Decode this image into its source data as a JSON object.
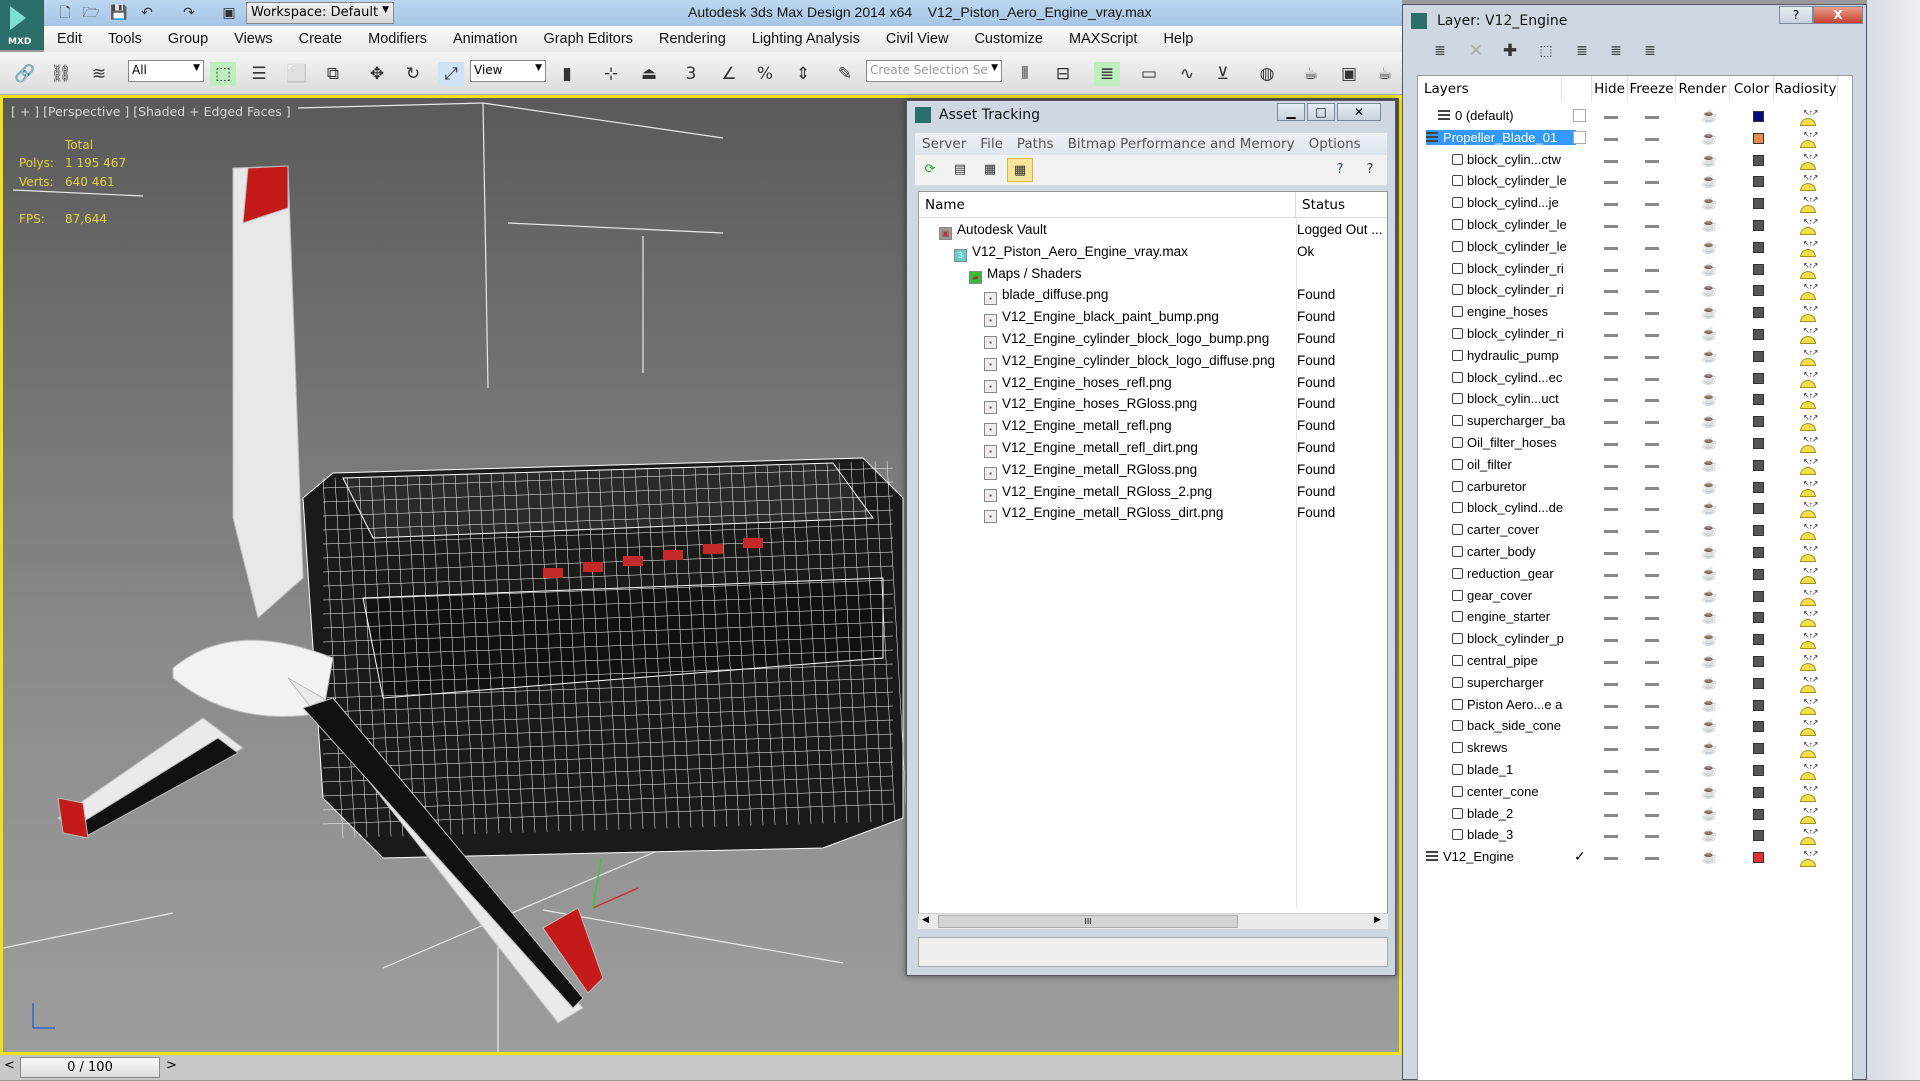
{
  "app": {
    "title": "Autodesk 3ds Max Design 2014 x64",
    "file": "V12_Piston_Aero_Engine_vray.max",
    "logo_text": "MXD",
    "workspace": "Workspace: Default"
  },
  "menu": [
    "Edit",
    "Tools",
    "Group",
    "Views",
    "Create",
    "Modifiers",
    "Animation",
    "Graph Editors",
    "Rendering",
    "Lighting Analysis",
    "Civil View",
    "Customize",
    "MAXScript",
    "Help"
  ],
  "toolbar": {
    "filter_value": "All",
    "coord_value": "View",
    "selection_set_placeholder": "Create Selection Se"
  },
  "viewport": {
    "label": "[ + ] [Perspective ] [Shaded + Edged Faces ]",
    "stats_header": "Total",
    "polys_label": "Polys:",
    "polys_value": "1 195 467",
    "verts_label": "Verts:",
    "verts_value": "640 461",
    "fps_label": "FPS:",
    "fps_value": "87,644"
  },
  "timeline": {
    "value": "0 / 100",
    "prev": "<",
    "next": ">"
  },
  "asset_tracking": {
    "title": "Asset Tracking",
    "menu": [
      "Server",
      "File",
      "Paths",
      "Bitmap Performance and Memory",
      "Options"
    ],
    "columns": {
      "name": "Name",
      "status": "Status"
    },
    "rows": [
      {
        "name": "Autodesk Vault",
        "status": "Logged Out ...",
        "level": 1,
        "icon": "vault"
      },
      {
        "name": "V12_Piston_Aero_Engine_vray.max",
        "status": "Ok",
        "level": 2,
        "icon": "max"
      },
      {
        "name": "Maps / Shaders",
        "status": "",
        "level": 3,
        "icon": "maps"
      },
      {
        "name": "blade_diffuse.png",
        "status": "Found",
        "level": 4,
        "icon": "bitmap"
      },
      {
        "name": "V12_Engine_black_paint_bump.png",
        "status": "Found",
        "level": 4,
        "icon": "bitmap"
      },
      {
        "name": "V12_Engine_cylinder_block_logo_bump.png",
        "status": "Found",
        "level": 4,
        "icon": "bitmap"
      },
      {
        "name": "V12_Engine_cylinder_block_logo_diffuse.png",
        "status": "Found",
        "level": 4,
        "icon": "bitmap"
      },
      {
        "name": "V12_Engine_hoses_refl.png",
        "status": "Found",
        "level": 4,
        "icon": "bitmap"
      },
      {
        "name": "V12_Engine_hoses_RGloss.png",
        "status": "Found",
        "level": 4,
        "icon": "bitmap"
      },
      {
        "name": "V12_Engine_metall_refl.png",
        "status": "Found",
        "level": 4,
        "icon": "bitmap"
      },
      {
        "name": "V12_Engine_metall_refl_dirt.png",
        "status": "Found",
        "level": 4,
        "icon": "bitmap"
      },
      {
        "name": "V12_Engine_metall_RGloss.png",
        "status": "Found",
        "level": 4,
        "icon": "bitmap"
      },
      {
        "name": "V12_Engine_metall_RGloss_2.png",
        "status": "Found",
        "level": 4,
        "icon": "bitmap"
      },
      {
        "name": "V12_Engine_metall_RGloss_dirt.png",
        "status": "Found",
        "level": 4,
        "icon": "bitmap"
      }
    ],
    "scroll_grip": "III"
  },
  "layer_dialog": {
    "title": "Layer: V12_Engine",
    "help": "?",
    "close": "X",
    "columns": {
      "layers": "Layers",
      "hide": "Hide",
      "freeze": "Freeze",
      "render": "Render",
      "color": "Color",
      "radiosity": "Radiosity"
    },
    "current_mark": "✓",
    "rows": [
      {
        "name": "0 (default)",
        "type": "layer",
        "color": "#0a0a80"
      },
      {
        "name": "Propeller_Blade_01",
        "type": "layer",
        "color": "#e88a4a",
        "selected": true
      },
      {
        "name": "block_cylin...ctw",
        "type": "object",
        "color": "#555555"
      },
      {
        "name": "block_cylinder_le",
        "type": "object",
        "color": "#555555"
      },
      {
        "name": "block_cylind...je",
        "type": "object",
        "color": "#555555"
      },
      {
        "name": "block_cylinder_le",
        "type": "object",
        "color": "#555555"
      },
      {
        "name": "block_cylinder_le",
        "type": "object",
        "color": "#555555"
      },
      {
        "name": "block_cylinder_ri",
        "type": "object",
        "color": "#555555"
      },
      {
        "name": "block_cylinder_ri",
        "type": "object",
        "color": "#555555"
      },
      {
        "name": "engine_hoses",
        "type": "object",
        "color": "#555555"
      },
      {
        "name": "block_cylinder_ri",
        "type": "object",
        "color": "#555555"
      },
      {
        "name": "hydraulic_pump",
        "type": "object",
        "color": "#555555"
      },
      {
        "name": "block_cylind...ec",
        "type": "object",
        "color": "#555555"
      },
      {
        "name": "block_cylin...uct",
        "type": "object",
        "color": "#555555"
      },
      {
        "name": "supercharger_ba",
        "type": "object",
        "color": "#555555"
      },
      {
        "name": "Oil_filter_hoses",
        "type": "object",
        "color": "#555555"
      },
      {
        "name": "oil_filter",
        "type": "object",
        "color": "#555555"
      },
      {
        "name": "carburetor",
        "type": "object",
        "color": "#555555"
      },
      {
        "name": "block_cylind...de",
        "type": "object",
        "color": "#555555"
      },
      {
        "name": "carter_cover",
        "type": "object",
        "color": "#555555"
      },
      {
        "name": "carter_body",
        "type": "object",
        "color": "#555555"
      },
      {
        "name": "reduction_gear",
        "type": "object",
        "color": "#555555"
      },
      {
        "name": "gear_cover",
        "type": "object",
        "color": "#555555"
      },
      {
        "name": "engine_starter",
        "type": "object",
        "color": "#555555"
      },
      {
        "name": "block_cylinder_p",
        "type": "object",
        "color": "#555555"
      },
      {
        "name": "central_pipe",
        "type": "object",
        "color": "#555555"
      },
      {
        "name": "supercharger",
        "type": "object",
        "color": "#555555"
      },
      {
        "name": "Piston Aero...e a",
        "type": "object",
        "color": "#555555"
      },
      {
        "name": "back_side_cone",
        "type": "object",
        "color": "#555555"
      },
      {
        "name": "skrews",
        "type": "object",
        "color": "#555555"
      },
      {
        "name": "blade_1",
        "type": "object",
        "color": "#555555"
      },
      {
        "name": "center_cone",
        "type": "object",
        "color": "#555555"
      },
      {
        "name": "blade_2",
        "type": "object",
        "color": "#555555"
      },
      {
        "name": "blade_3",
        "type": "object",
        "color": "#555555"
      },
      {
        "name": "V12_Engine",
        "type": "layer",
        "color": "#e03030",
        "current": true
      }
    ]
  }
}
